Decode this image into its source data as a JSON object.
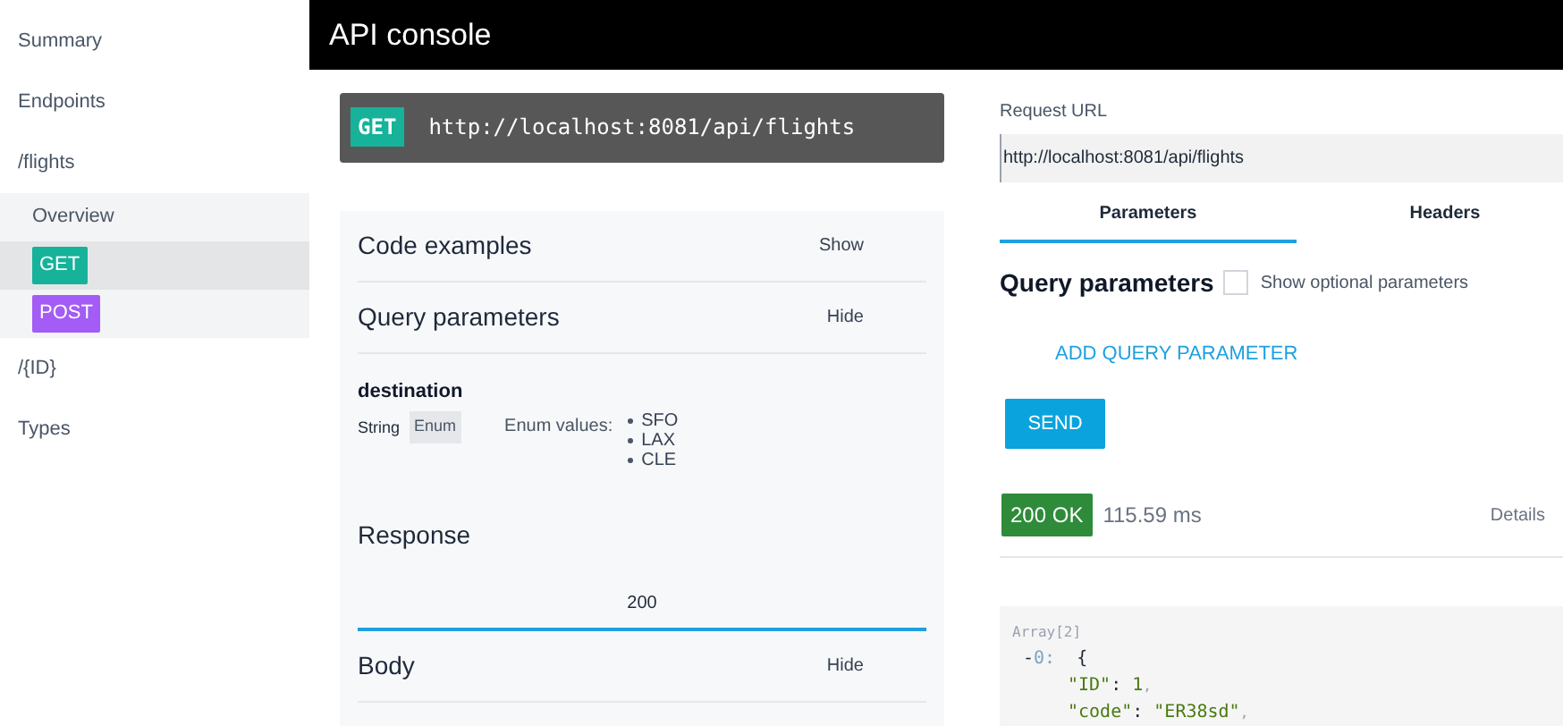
{
  "sidebar": {
    "items": [
      {
        "label": "Summary",
        "kind": "link",
        "selected": false
      },
      {
        "label": "Endpoints",
        "kind": "link",
        "selected": false
      },
      {
        "label": "/flights",
        "kind": "link",
        "selected": false
      },
      {
        "label": "Overview",
        "kind": "sub",
        "selected": false
      },
      {
        "label": "GET",
        "kind": "method",
        "color": "#16b29a",
        "selected": true
      },
      {
        "label": "POST",
        "kind": "method",
        "color": "#a35cf5",
        "selected": false
      },
      {
        "label": "/{ID}",
        "kind": "link",
        "selected": false
      },
      {
        "label": "Types",
        "kind": "link",
        "selected": false
      }
    ]
  },
  "header": {
    "title": "API console"
  },
  "endpoint": {
    "method": "GET",
    "url": "http://localhost:8081/api/flights"
  },
  "doc": {
    "sections": [
      {
        "title": "Code examples",
        "toggle": "Show"
      },
      {
        "title": "Query parameters",
        "toggle": "Hide"
      }
    ],
    "parameter": {
      "name": "destination",
      "type": "String",
      "badge": "Enum",
      "enum_label": "Enum values:",
      "enum_values": [
        "SFO",
        "LAX",
        "CLE"
      ]
    },
    "response": {
      "title": "Response",
      "tabs": [
        {
          "label": "200",
          "selected": true
        }
      ]
    },
    "body": {
      "title": "Body",
      "toggle": "Hide"
    }
  },
  "console": {
    "url_label": "Request URL",
    "url": "http://localhost:8081/api/flights",
    "tabs": [
      {
        "label": "Parameters",
        "selected": true
      },
      {
        "label": "Headers",
        "selected": false
      }
    ],
    "query_title": "Query parameters",
    "optional": {
      "label": "Show optional parameters",
      "checked": false
    },
    "add_param": "ADD QUERY PARAMETER",
    "send": "SEND",
    "status": {
      "code": "200 OK",
      "time": "115.59 ms",
      "details": "Details"
    },
    "json_lines": [
      [
        {
          "kind": "meta",
          "text": "Array[2]"
        }
      ],
      [
        {
          "kind": "punct",
          "text": "-"
        },
        {
          "kind": "index",
          "text": "0:"
        },
        {
          "kind": "punct",
          "text": "{"
        }
      ],
      [
        {
          "kind": "key",
          "text": "\"ID\""
        },
        {
          "kind": "punct",
          "text": ":"
        },
        {
          "kind": "value",
          "text": "1"
        },
        {
          "kind": "meta",
          "text": ","
        }
      ],
      [
        {
          "kind": "key",
          "text": "\"code\""
        },
        {
          "kind": "punct",
          "text": ":"
        },
        {
          "kind": "value",
          "text": "\"ER38sd\""
        },
        {
          "kind": "meta",
          "text": ","
        }
      ]
    ]
  }
}
